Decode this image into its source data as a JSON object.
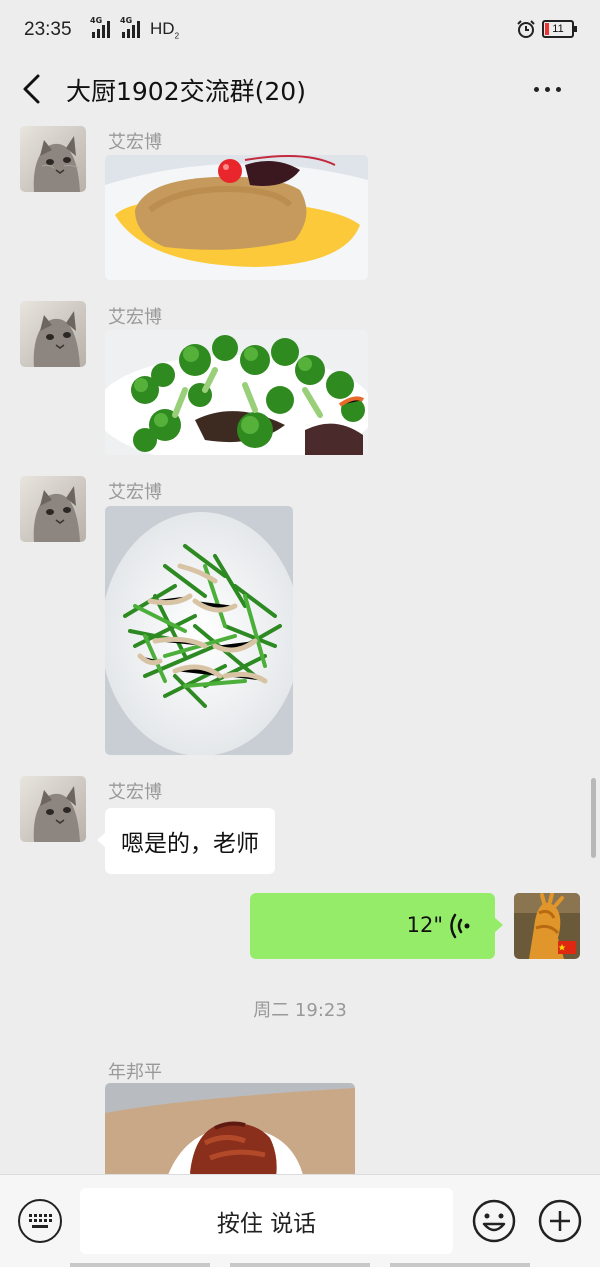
{
  "status_bar": {
    "time": "23:35",
    "network_1": "4G",
    "network_2": "4G",
    "hd": "HD",
    "hd_sub": "2",
    "battery": "11"
  },
  "nav": {
    "title": "大厨1902交流群(20)"
  },
  "messages": {
    "m1_sender": "艾宏博",
    "m2_sender": "艾宏博",
    "m3_sender": "艾宏博",
    "m4_sender": "艾宏博",
    "m4_text": "嗯是的，老师",
    "voice_duration": "12\"",
    "timestamp": "周二 19:23",
    "m6_sender": "年邦平"
  },
  "input_bar": {
    "hold_to_talk": "按住 说话"
  },
  "colors": {
    "sent_bubble": "#95ec69",
    "background": "#ededed"
  }
}
